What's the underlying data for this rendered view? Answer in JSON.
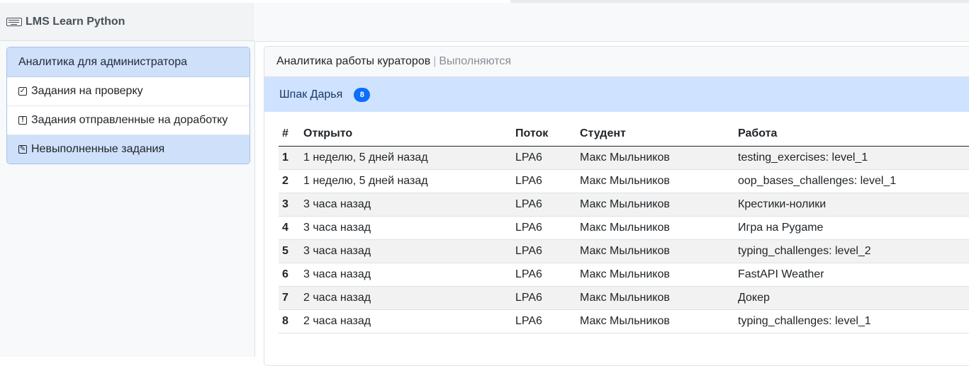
{
  "brand": {
    "title": "LMS Learn Python",
    "icon": "keyboard-icon"
  },
  "sidebar": {
    "heading": "Аналитика для администратора",
    "items": [
      {
        "label": "Задания на проверку",
        "icon": "check-square-icon",
        "active": false
      },
      {
        "label": "Задания отправленные на доработку",
        "icon": "exclamation-square-icon",
        "active": false
      },
      {
        "label": "Невыполненные задания",
        "icon": "pencil-square-icon",
        "active": true
      }
    ]
  },
  "card": {
    "title": "Аналитика работы кураторов",
    "separator": "|",
    "subtitle": "Выполняются",
    "curator": {
      "name": "Шпак Дарья",
      "count": "8"
    }
  },
  "table": {
    "headers": [
      "#",
      "Открыто",
      "Поток",
      "Студент",
      "Работа"
    ],
    "rows": [
      [
        "1",
        "1 неделю, 5 дней назад",
        "LPA6",
        "Макс Мыльников",
        "testing_exercises: level_1"
      ],
      [
        "2",
        "1 неделю, 5 дней назад",
        "LPA6",
        "Макс Мыльников",
        "oop_bases_challenges: level_1"
      ],
      [
        "3",
        "3 часа назад",
        "LPA6",
        "Макс Мыльников",
        "Крестики-нолики"
      ],
      [
        "4",
        "3 часа назад",
        "LPA6",
        "Макс Мыльников",
        "Игра на Pygame"
      ],
      [
        "5",
        "3 часа назад",
        "LPA6",
        "Макс Мыльников",
        "typing_challenges: level_2"
      ],
      [
        "6",
        "3 часа назад",
        "LPA6",
        "Макс Мыльников",
        "FastAPI Weather"
      ],
      [
        "7",
        "2 часа назад",
        "LPA6",
        "Макс Мыльников",
        "Докер"
      ],
      [
        "8",
        "2 часа назад",
        "LPA6",
        "Макс Мыльников",
        "typing_challenges: level_1"
      ]
    ]
  },
  "colors": {
    "accent": "#0d6efd",
    "active_bg": "#cfe0fb",
    "curator_bg": "#cfe2ff"
  }
}
